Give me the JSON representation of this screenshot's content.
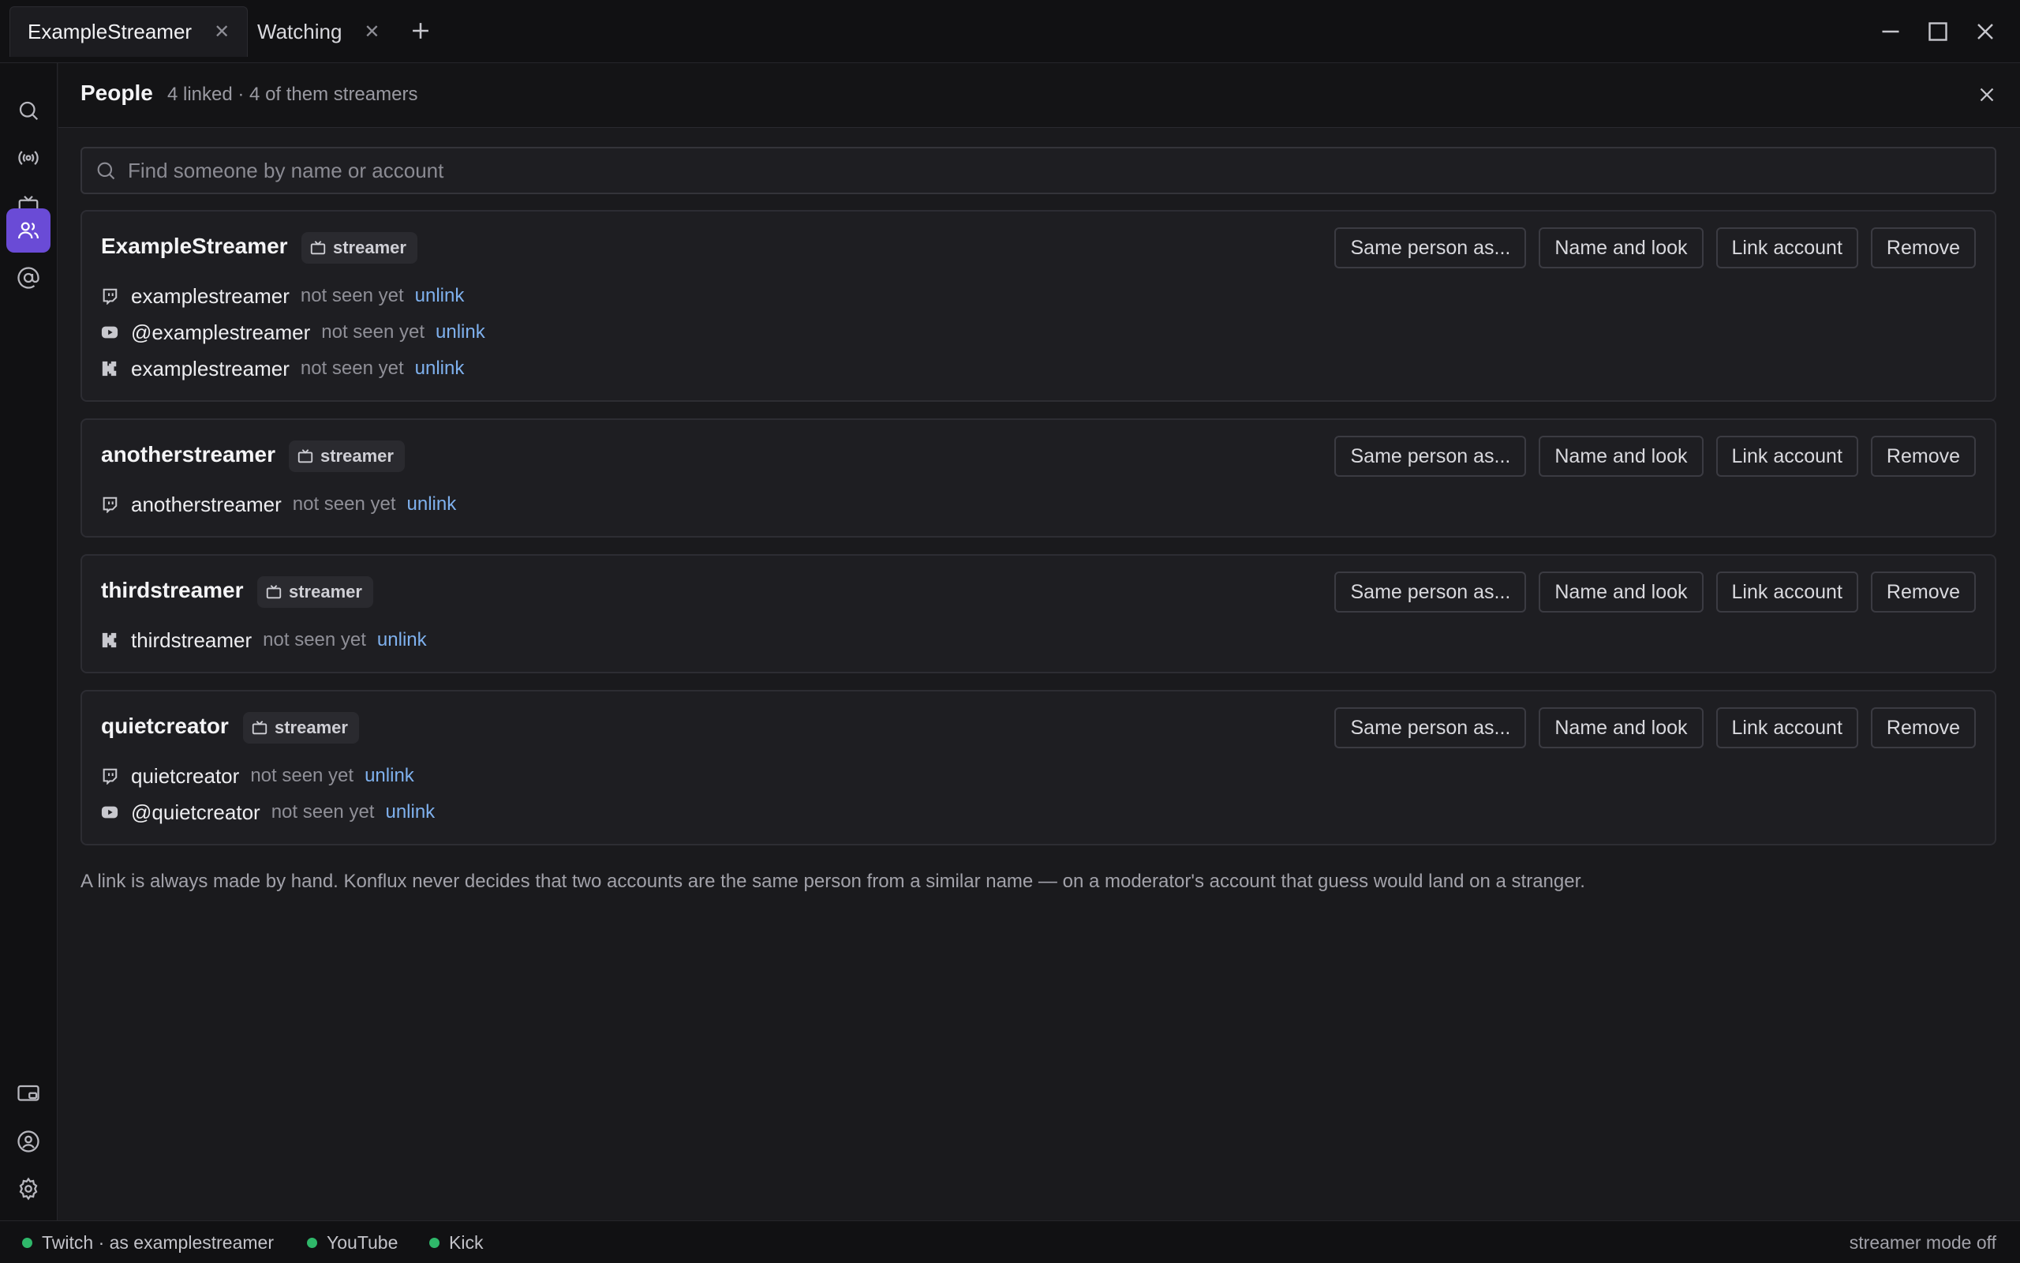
{
  "tabs": [
    {
      "label": "ExampleStreamer",
      "active": true
    },
    {
      "label": "Watching",
      "active": false
    }
  ],
  "icons": {
    "new_tab": "plus-icon",
    "minimize": "minimize-icon",
    "maximize": "maximize-icon",
    "close": "close-icon"
  },
  "sidebar": {
    "top": [
      "search-icon",
      "broadcast-icon",
      "tv-icon",
      "people-icon",
      "at-icon"
    ],
    "bottom": [
      "cast-icon",
      "account-icon",
      "settings-icon"
    ],
    "active": "people-icon"
  },
  "header": {
    "title": "People",
    "subtitle": "4 linked · 4 of them streamers"
  },
  "search": {
    "placeholder": "Find someone by name or account"
  },
  "actions": {
    "same_person": "Same person as...",
    "name_and_look": "Name and look",
    "link_account": "Link account",
    "remove": "Remove"
  },
  "people": [
    {
      "name": "ExampleStreamer",
      "badge": "streamer",
      "accounts": [
        {
          "platform": "twitch",
          "handle": "examplestreamer",
          "status": "not seen yet",
          "action": "unlink"
        },
        {
          "platform": "youtube",
          "handle": "@examplestreamer",
          "status": "not seen yet",
          "action": "unlink"
        },
        {
          "platform": "kick",
          "handle": "examplestreamer",
          "status": "not seen yet",
          "action": "unlink"
        }
      ]
    },
    {
      "name": "anotherstreamer",
      "badge": "streamer",
      "accounts": [
        {
          "platform": "twitch",
          "handle": "anotherstreamer",
          "status": "not seen yet",
          "action": "unlink"
        }
      ]
    },
    {
      "name": "thirdstreamer",
      "badge": "streamer",
      "accounts": [
        {
          "platform": "kick",
          "handle": "thirdstreamer",
          "status": "not seen yet",
          "action": "unlink"
        }
      ]
    },
    {
      "name": "quietcreator",
      "badge": "streamer",
      "accounts": [
        {
          "platform": "twitch",
          "handle": "quietcreator",
          "status": "not seen yet",
          "action": "unlink"
        },
        {
          "platform": "youtube",
          "handle": "@quietcreator",
          "status": "not seen yet",
          "action": "unlink"
        }
      ]
    }
  ],
  "note": "A link is always made by hand. Konflux never decides that two accounts are the same person from a similar name — on a moderator's account that guess would land on a stranger.",
  "statusbar": {
    "connections": [
      {
        "label": "Twitch · as examplestreamer",
        "color": "#2fb86a"
      },
      {
        "label": "YouTube",
        "color": "#2fb86a"
      },
      {
        "label": "Kick",
        "color": "#2fb86a"
      }
    ],
    "streamer_mode": "streamer mode off"
  }
}
